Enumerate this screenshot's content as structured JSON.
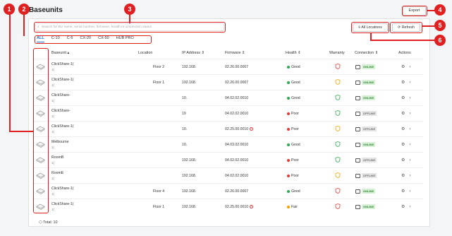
{
  "page": {
    "title": "Baseunits",
    "export_label": "Export",
    "search_placeholder": "Search for BU name, serial number, firmware, health or connection status",
    "all_locations_label": "All Locations",
    "refresh_label": "Refresh",
    "total_label": "Total: 10"
  },
  "tabs": [
    "ALL",
    "C-10",
    "C-5",
    "CX-20",
    "CX-50",
    "HUB PRO"
  ],
  "columns": {
    "baseunit": "Baseunit",
    "location": "Location",
    "ip": "IP Address",
    "firmware": "Firmware",
    "health": "Health",
    "warranty": "Warranty",
    "connection": "Connection",
    "actions": "Actions"
  },
  "rows": [
    {
      "name": "ClickShare-1(",
      "serial": "1(",
      "location": "Floor 2",
      "ip": "192.168.",
      "firmware": "02.26.00.0007",
      "fw_warn": false,
      "health": "Good",
      "warranty": "red",
      "connection": "ONLINE"
    },
    {
      "name": "ClickShare-1(",
      "serial": "1(",
      "location": "Floor 1",
      "ip": "192.168.",
      "firmware": "02.26.00.0007",
      "fw_warn": false,
      "health": "Good",
      "warranty": "orange",
      "connection": "ONLINE"
    },
    {
      "name": "ClickShare-",
      "serial": "1(",
      "location": "",
      "ip": "10.",
      "firmware": "04.02.02.0010",
      "fw_warn": false,
      "health": "Good",
      "warranty": "green",
      "connection": "ONLINE"
    },
    {
      "name": "ClickShare-",
      "serial": "1(",
      "location": "",
      "ip": "19",
      "firmware": "04.02.02.0010",
      "fw_warn": false,
      "health": "Poor",
      "warranty": "green",
      "connection": "OFFLINE"
    },
    {
      "name": "ClickShare-1(",
      "serial": "1(",
      "location": "",
      "ip": "10.",
      "firmware": "02.25.00.0010",
      "fw_warn": true,
      "health": "Poor",
      "warranty": "orange",
      "connection": "OFFLINE"
    },
    {
      "name": "Melbourne",
      "serial": "1(",
      "location": "",
      "ip": "10.",
      "firmware": "04.03.02.0010",
      "fw_warn": false,
      "health": "Good",
      "warranty": "green",
      "connection": "ONLINE"
    },
    {
      "name": "RoomB",
      "serial": "1(",
      "location": "",
      "ip": "192.168.",
      "firmware": "04.02.02.0010",
      "fw_warn": false,
      "health": "Poor",
      "warranty": "green",
      "connection": "OFFLINE"
    },
    {
      "name": "RoomE",
      "serial": "1(",
      "location": "",
      "ip": "192.168.",
      "firmware": "04.02.02.0010",
      "fw_warn": false,
      "health": "Poor",
      "warranty": "orange",
      "connection": "OFFLINE"
    },
    {
      "name": "ClickShare-1(",
      "serial": "1(",
      "location": "Floor 4",
      "ip": "192.168.",
      "firmware": "02.26.00.0007",
      "fw_warn": false,
      "health": "Good",
      "warranty": "red",
      "connection": "ONLINE"
    },
    {
      "name": "ClickShare-1(",
      "serial": "1(",
      "location": "Floor 1",
      "ip": "192.168.",
      "firmware": "02.25.00.0010",
      "fw_warn": true,
      "health": "Fair",
      "warranty": "red",
      "connection": "ONLINE"
    }
  ],
  "colors": {
    "good": "#2fa84f",
    "poor": "#e53935",
    "fair": "#f2a300",
    "accent": "#1d6fd6",
    "annotation": "#e02020"
  },
  "annotations": [
    "1",
    "2",
    "3",
    "4",
    "5",
    "6"
  ]
}
